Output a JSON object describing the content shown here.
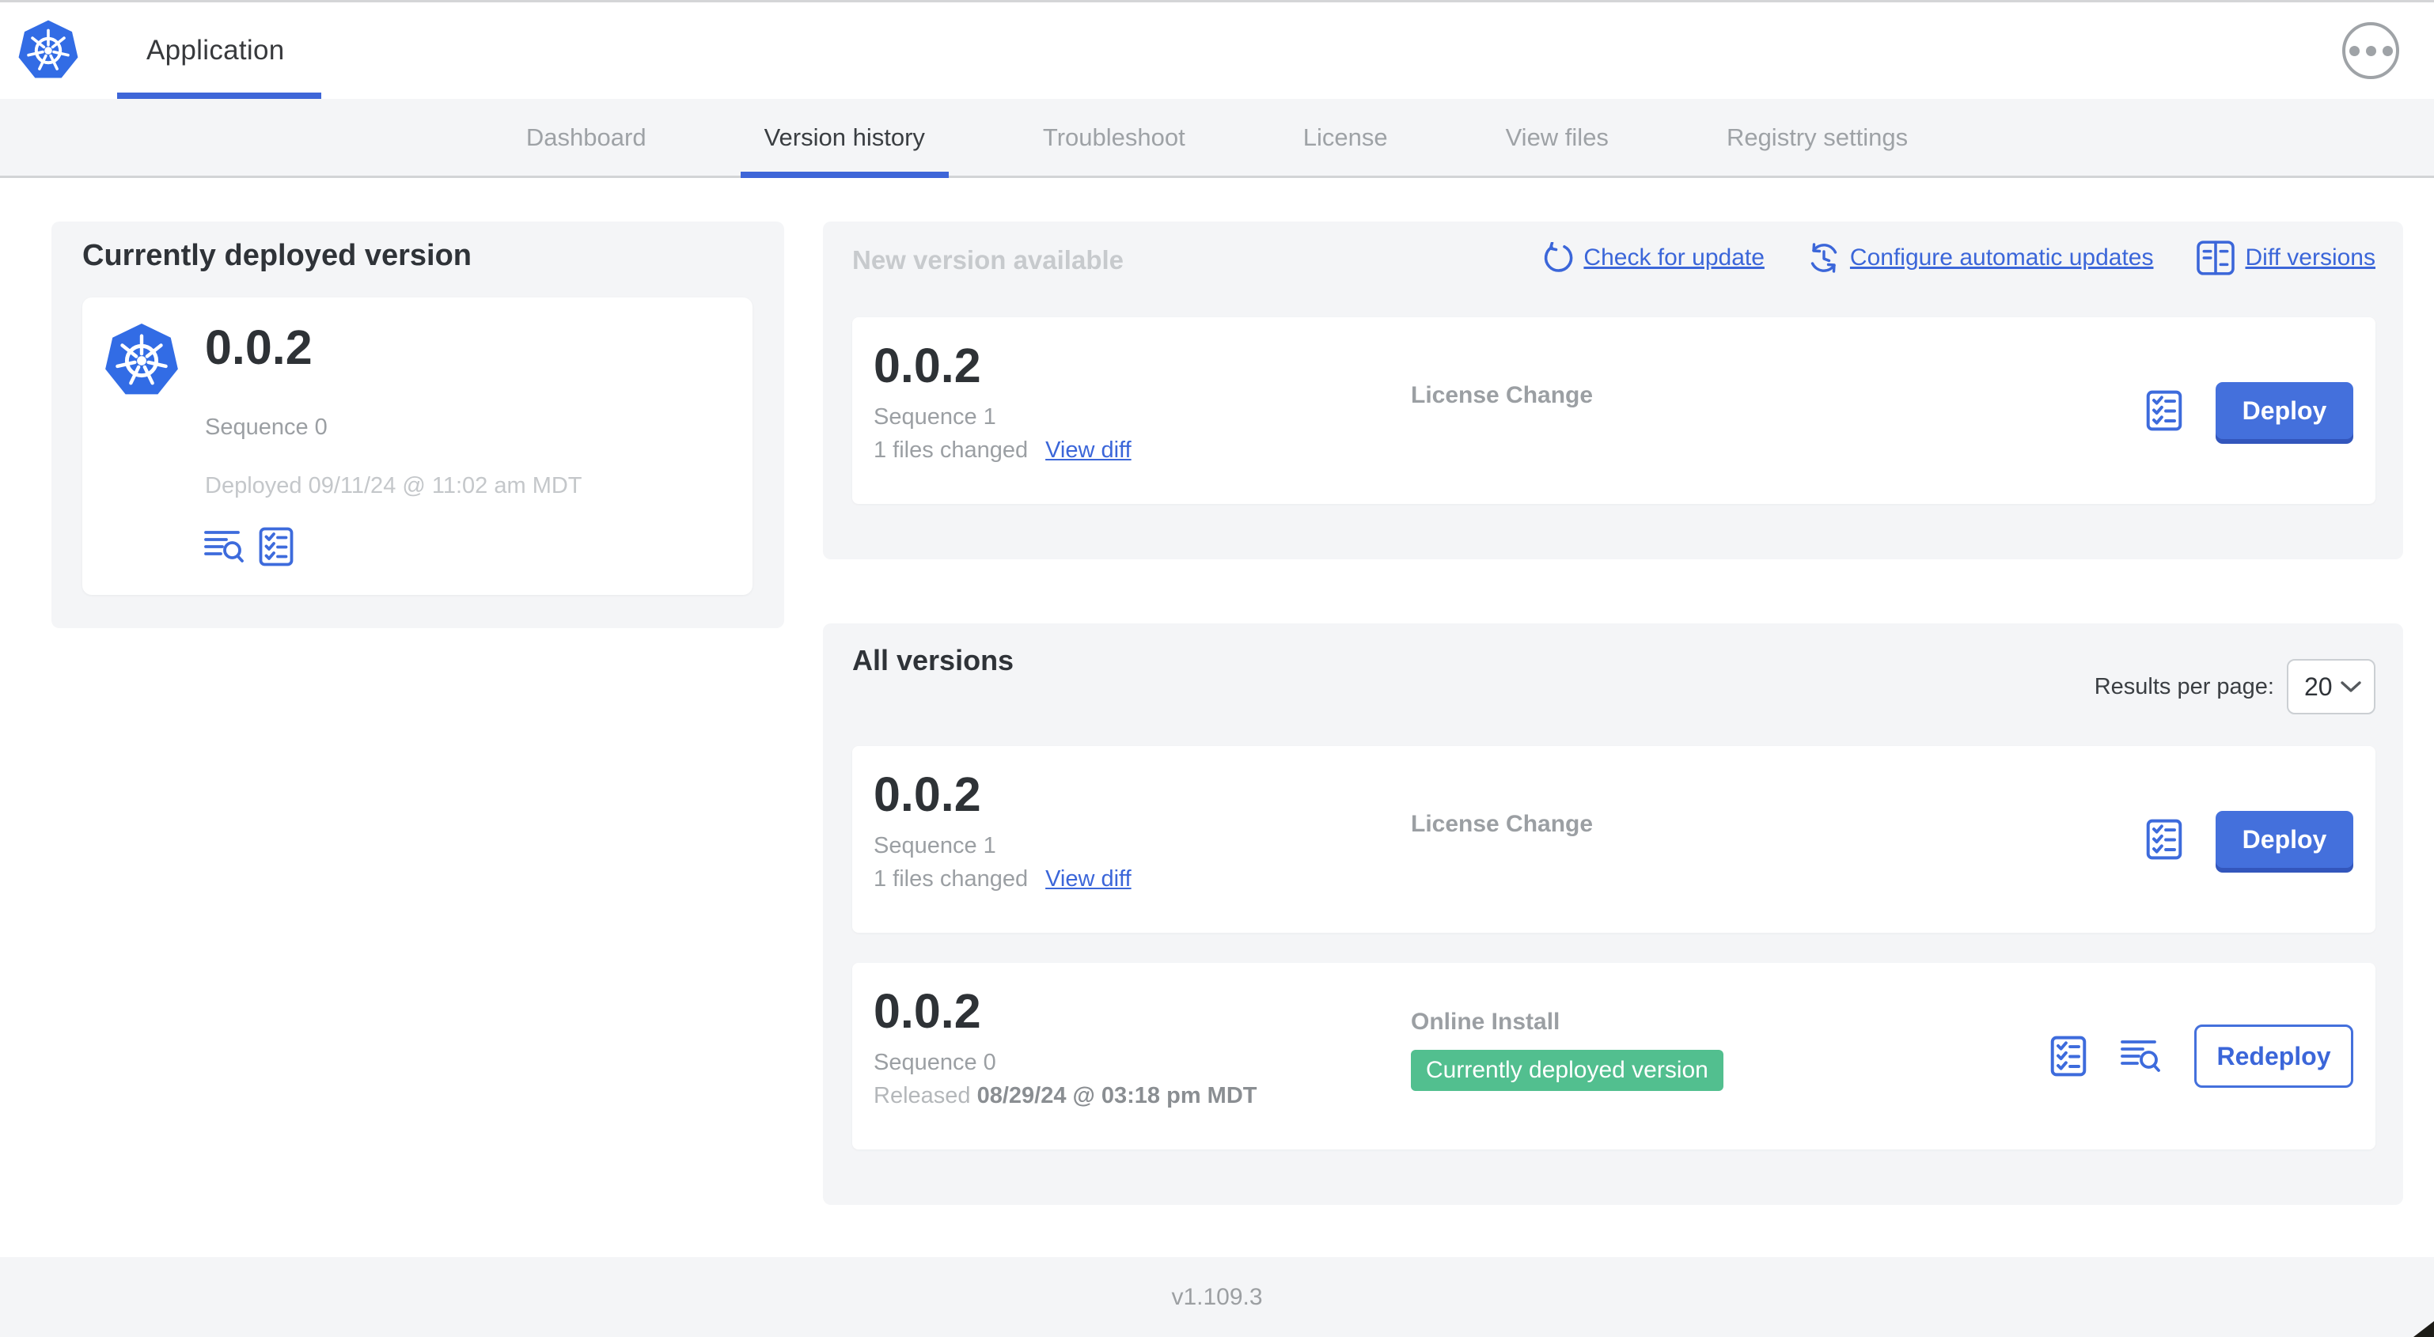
{
  "header": {
    "title": "Application"
  },
  "tabs": {
    "items": [
      {
        "label": "Dashboard",
        "active": false
      },
      {
        "label": "Version history",
        "active": true
      },
      {
        "label": "Troubleshoot",
        "active": false
      },
      {
        "label": "License",
        "active": false
      },
      {
        "label": "View files",
        "active": false
      },
      {
        "label": "Registry settings",
        "active": false
      }
    ]
  },
  "current": {
    "heading": "Currently deployed version",
    "version": "0.0.2",
    "sequence": "Sequence 0",
    "deployed": "Deployed 09/11/24 @ 11:02 am MDT"
  },
  "new_version": {
    "heading": "New version available",
    "actions": {
      "check": "Check for update",
      "configure": "Configure automatic updates",
      "diff": "Diff versions"
    },
    "row": {
      "version": "0.0.2",
      "sequence": "Sequence 1",
      "files_changed": "1 files changed",
      "view_diff": "View diff",
      "source": "License Change",
      "deploy_label": "Deploy"
    }
  },
  "all_versions": {
    "heading": "All versions",
    "results_label": "Results per page:",
    "results_value": "20",
    "rows": [
      {
        "version": "0.0.2",
        "sequence": "Sequence 1",
        "files_changed": "1 files changed",
        "view_diff": "View diff",
        "source": "License Change",
        "action": "Deploy"
      },
      {
        "version": "0.0.2",
        "sequence": "Sequence 0",
        "released_prefix": "Released ",
        "released_date": "08/29/24 @ 03:18 pm MDT",
        "source": "Online Install",
        "badge": "Currently deployed version",
        "action": "Redeploy"
      }
    ]
  },
  "footer": {
    "app_version": "v1.109.3"
  },
  "colors": {
    "primary_blue": "#3B66D9",
    "button_blue": "#4470DC",
    "button_blue_shadow": "#3356BC",
    "kubernetes_blue": "#326CE5",
    "badge_green": "#52BF8F",
    "tab_bar_bg": "#F4F5F7"
  }
}
